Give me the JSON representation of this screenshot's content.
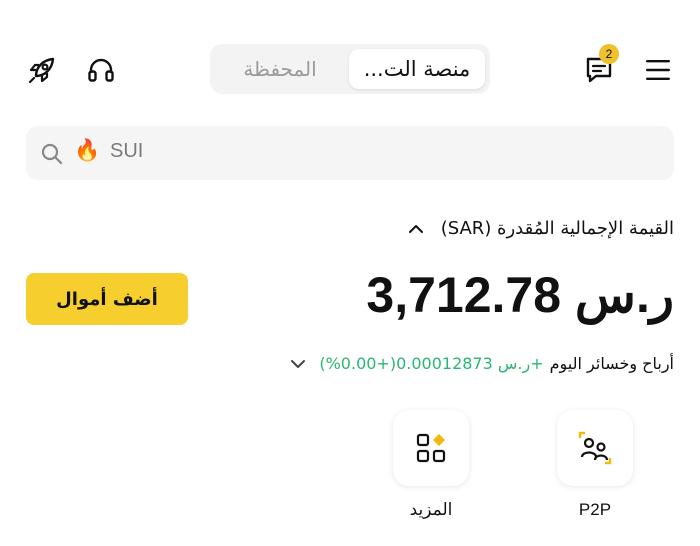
{
  "header": {
    "tabs": [
      {
        "label": "منصة الت...",
        "active": true
      },
      {
        "label": "المحفظة",
        "active": false
      }
    ],
    "notification_count": "2",
    "icons": {
      "menu": "hamburger-menu-icon",
      "messages": "chat-bubble-icon",
      "support": "headset-icon",
      "referral": "rocket-icon"
    }
  },
  "search": {
    "placeholder": "SUI",
    "emoji": "🔥"
  },
  "balance": {
    "label": "القيمة الإجمالية المُقدرة (SAR)",
    "amount": "ر.س 3,712.78",
    "add_funds_label": "أضف أموال",
    "pnl_label": "أرباح وخسائر اليوم",
    "pnl_value": "+ر.س 0.00012873(+0.00%)"
  },
  "shortcuts": [
    {
      "label": "P2P",
      "icon": "p2p-users-icon"
    },
    {
      "label": "المزيد",
      "icon": "more-grid-icon"
    }
  ],
  "colors": {
    "accent": "#f6cf2f",
    "positive": "#2bb673",
    "badge": "#f0c12d"
  }
}
